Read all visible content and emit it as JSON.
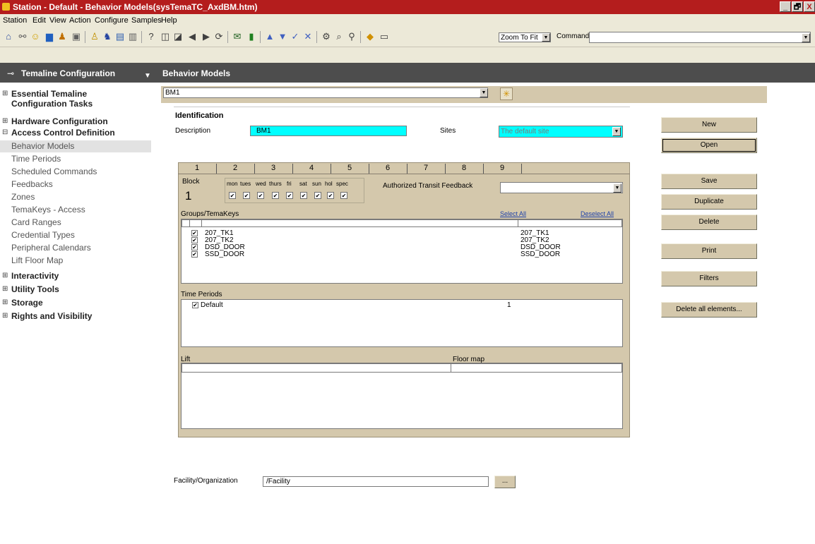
{
  "window": {
    "title": "Station - Default - Behavior Models(sysTemaTC_AxdBM.htm)",
    "controls": [
      "_",
      "🗗",
      "X"
    ]
  },
  "menu": [
    "Station",
    "Edit",
    "View",
    "Action",
    "Configure",
    "Samples",
    "Help"
  ],
  "toolbar": {
    "zoom_value": "Zoom To Fit",
    "command_label": "Command",
    "command_value": ""
  },
  "nav": {
    "title": "Temaline Configuration",
    "groups": {
      "essential": "Essential Temaline Configuration Tasks",
      "hardware": "Hardware Configuration",
      "access": "Access Control Definition",
      "interactivity": "Interactivity",
      "utility": "Utility Tools",
      "storage": "Storage",
      "rights": "Rights and Visibility"
    },
    "access_items": [
      "Behavior Models",
      "Time Periods",
      "Scheduled Commands",
      "Feedbacks",
      "Zones",
      "TemaKeys - Access",
      "Card Ranges",
      "Credential Types",
      "Peripheral Calendars",
      "Lift Floor Map"
    ],
    "selected": "Behavior Models",
    "expand_plus": "⊞",
    "expand_minus": "⊟"
  },
  "main": {
    "title": "Behavior Models",
    "model_combo": "BM1",
    "identification": "Identification",
    "description_label": "Description",
    "description_value": "BM1",
    "sites_label": "Sites",
    "sites_value": "The default site",
    "tabs": [
      "1",
      "2",
      "3",
      "4",
      "5",
      "6",
      "7",
      "8",
      "9"
    ],
    "active_tab": "1",
    "block_label": "Block",
    "block_value": "1",
    "days": [
      "mon",
      "tues",
      "wed",
      "thurs",
      "fri",
      "sat",
      "sun",
      "hol",
      "spec"
    ],
    "day_checked": "☑",
    "atf_label": "Authorized Transit Feedback",
    "atf_value": "",
    "groups_label": "Groups/TemaKeys",
    "select_all": "Select All",
    "deselect_all": "Deselect All",
    "groups": [
      {
        "name": "207_TK1",
        "value": "207_TK1"
      },
      {
        "name": "207_TK2",
        "value": "207_TK2"
      },
      {
        "name": "DSD_DOOR",
        "value": "DSD_DOOR"
      },
      {
        "name": "SSD_DOOR",
        "value": "SSD_DOOR"
      }
    ],
    "time_periods_label": "Time Periods",
    "time_periods": [
      {
        "name": "Default",
        "value": "1"
      }
    ],
    "lift_label": "Lift",
    "floor_map_label": "Floor map",
    "facility_label": "Facility/Organization",
    "facility_value": "/Facility",
    "facility_button": "...",
    "check_mark": "✔"
  },
  "actions": [
    "New",
    "Open",
    "Save",
    "Duplicate",
    "Delete",
    "Print",
    "Filters",
    "Delete all elements..."
  ]
}
